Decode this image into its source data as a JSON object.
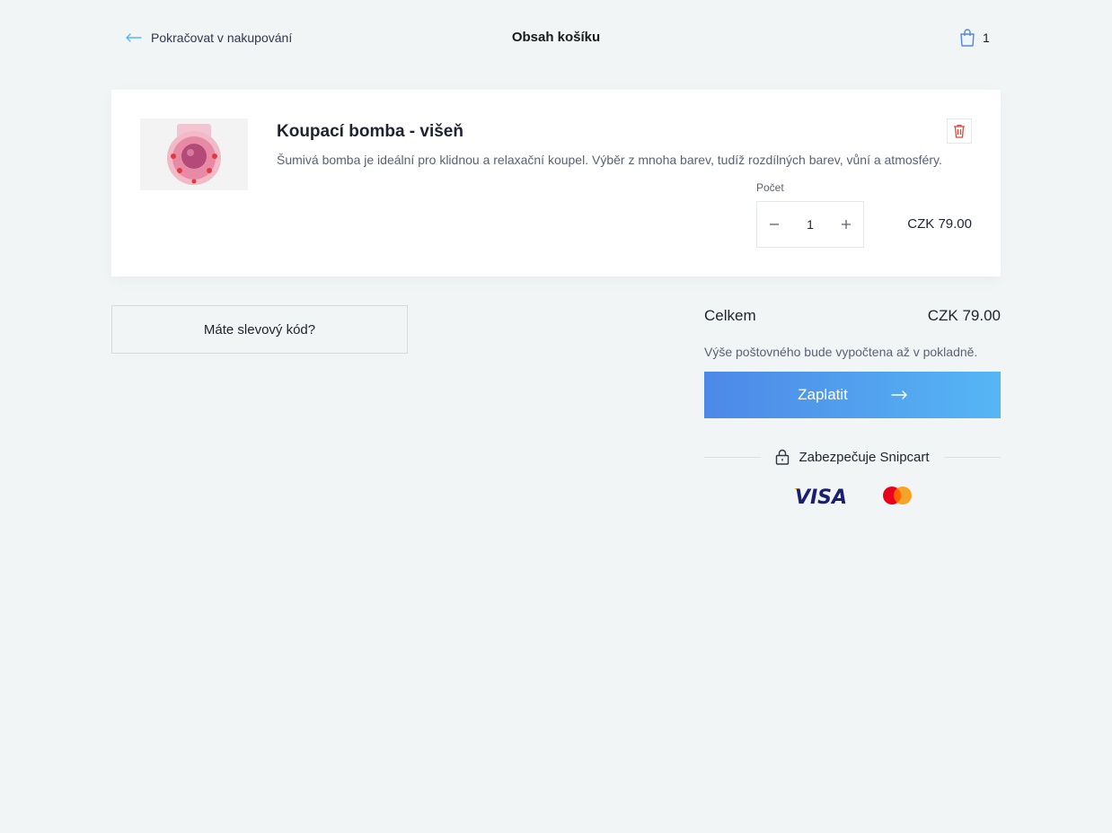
{
  "header": {
    "back_label": "Pokračovat v nakupování",
    "title": "Obsah košíku",
    "cart_count": "1"
  },
  "item": {
    "name": "Koupací bomba - višeň",
    "description": "Šumivá bomba je ideální pro klidnou a relaxační koupel. Výběr z mnoha barev, tudíž rozdílných barev, vůní a atmosféry.",
    "quantity_label": "Počet",
    "quantity": "1",
    "price": "CZK 79.00"
  },
  "discount": {
    "label": "Máte slevový kód?"
  },
  "summary": {
    "total_label": "Celkem",
    "total_value": "CZK 79.00",
    "shipping_note": "Výše poštovného bude vypočtena až v pokladně.",
    "checkout_label": "Zaplatit",
    "secured_label": "Zabezpečuje Snipcart"
  },
  "payment_brands": {
    "visa": "VISA",
    "mastercard": "mastercard"
  },
  "colors": {
    "background": "#f1f5f5",
    "accent": "#4d88e8",
    "accent_end": "#56b6f4",
    "delete": "#e0483a",
    "visa_blue": "#1a1f71",
    "visa_gold": "#f7a600",
    "mc_red": "#eb001b",
    "mc_yellow": "#f79e1b"
  },
  "icons": {
    "back": "arrow-left-icon",
    "cart": "shopping-bag-icon",
    "delete": "trash-icon",
    "minus": "minus-icon",
    "plus": "plus-icon",
    "checkout": "arrow-right-icon",
    "lock": "lock-icon"
  }
}
